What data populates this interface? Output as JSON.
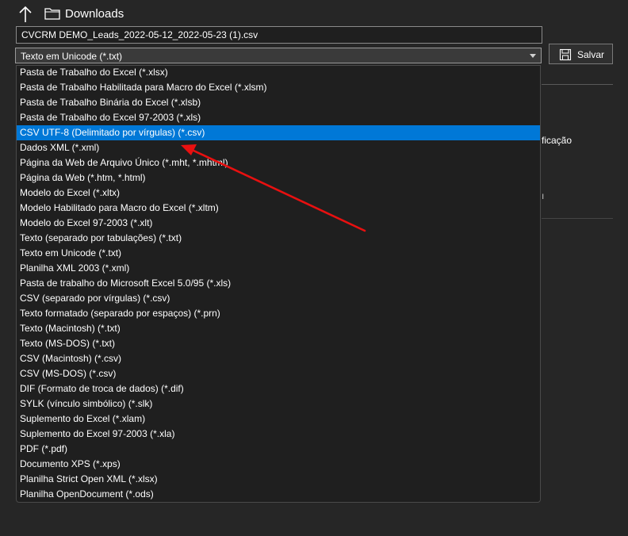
{
  "toolbar": {
    "up_icon": "arrow-up-icon",
    "folder_icon": "folder-icon",
    "location": "Downloads"
  },
  "filename": {
    "value": "CVCRM DEMO_Leads_2022-05-12_2022-05-23 (1).csv"
  },
  "filetype": {
    "selected": "Texto em Unicode (*.txt)",
    "chevron_icon": "chevron-down-icon"
  },
  "save_button": {
    "label": "Salvar",
    "icon": "save-icon"
  },
  "background": {
    "fragment_1": "ficação",
    "fragment_2": "ı"
  },
  "dropdown": {
    "options": [
      "Pasta de Trabalho do Excel (*.xlsx)",
      "Pasta de Trabalho Habilitada para Macro do Excel (*.xlsm)",
      "Pasta de Trabalho Binária do Excel (*.xlsb)",
      "Pasta de Trabalho do Excel 97-2003 (*.xls)",
      "CSV UTF-8 (Delimitado por vírgulas) (*.csv)",
      "Dados XML (*.xml)",
      "Página da Web de Arquivo Único (*.mht, *.mhtml)",
      "Página da Web (*.htm, *.html)",
      "Modelo do Excel (*.xltx)",
      "Modelo Habilitado para Macro do Excel (*.xltm)",
      "Modelo do Excel 97-2003 (*.xlt)",
      "Texto (separado por tabulações) (*.txt)",
      "Texto em Unicode (*.txt)",
      "Planilha XML 2003 (*.xml)",
      "Pasta de trabalho do Microsoft Excel 5.0/95 (*.xls)",
      "CSV (separado por vírgulas) (*.csv)",
      "Texto formatado (separado por espaços) (*.prn)",
      "Texto (Macintosh) (*.txt)",
      "Texto (MS-DOS) (*.txt)",
      "CSV (Macintosh) (*.csv)",
      "CSV (MS-DOS) (*.csv)",
      "DIF (Formato de troca de dados) (*.dif)",
      "SYLK (vínculo simbólico) (*.slk)",
      "Suplemento do Excel (*.xlam)",
      "Suplemento do Excel 97-2003 (*.xla)",
      "PDF (*.pdf)",
      "Documento XPS (*.xps)",
      "Planilha Strict Open XML (*.xlsx)",
      "Planilha OpenDocument (*.ods)"
    ],
    "highlighted_index": 4,
    "highlight_color": "#0078d7"
  },
  "annotation": {
    "arrow_color": "#e81010",
    "arrow_icon": "red-arrow-annotation"
  }
}
